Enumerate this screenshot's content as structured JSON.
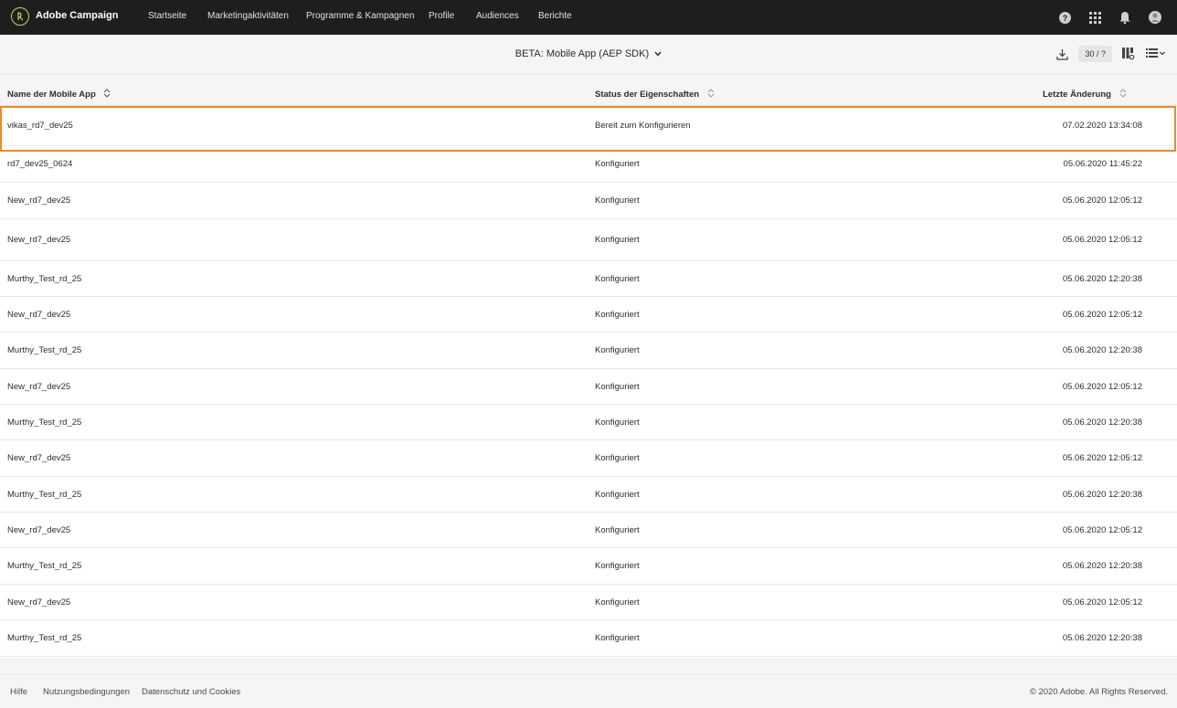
{
  "app": {
    "brand": "Adobe Campaign",
    "accent_color": "#c9d35a"
  },
  "nav": {
    "items": [
      "Startseite",
      "Marketingaktivitäten",
      "Programme & Kampagnen",
      "Profile",
      "Audiences",
      "Berichte"
    ],
    "icons": [
      "help-icon",
      "apps-grid-icon",
      "bell-icon",
      "user-avatar-icon"
    ]
  },
  "toolbar": {
    "view_title": "BETA: Mobile App (AEP SDK)",
    "counter": "30 / ?",
    "icons": [
      "download-icon",
      "column-config-icon",
      "list-view-icon"
    ]
  },
  "table": {
    "headers": {
      "name": "Name der Mobile App",
      "status": "Status der Eigenschaften",
      "modified": "Letzte Änderung"
    },
    "selected_row": 0,
    "highlight_color": "#e88b2e",
    "rows": [
      {
        "name": "vikas_rd7_dev25",
        "status": "Bereit zum Konfigurieren",
        "modified": "07.02.2020 13:34:08"
      },
      {
        "name": "rd7_dev25_0624",
        "status": "Konfiguriert",
        "modified": "05.06.2020 11:45:22"
      },
      {
        "name": "New_rd7_dev25",
        "status": "Konfiguriert",
        "modified": "05.06.2020 12:05:12"
      },
      {
        "name": "New_rd7_dev25",
        "status": "Konfiguriert",
        "modified": "05.06.2020 12:05:12"
      },
      {
        "name": "Murthy_Test_rd_25",
        "status": "Konfiguriert",
        "modified": "05.06.2020 12:20:38"
      },
      {
        "name": "New_rd7_dev25",
        "status": "Konfiguriert",
        "modified": "05.06.2020 12:05:12"
      },
      {
        "name": "Murthy_Test_rd_25",
        "status": "Konfiguriert",
        "modified": "05.06.2020 12:20:38"
      },
      {
        "name": "New_rd7_dev25",
        "status": "Konfiguriert",
        "modified": "05.06.2020 12:05:12"
      },
      {
        "name": "Murthy_Test_rd_25",
        "status": "Konfiguriert",
        "modified": "05.06.2020 12:20:38"
      },
      {
        "name": "New_rd7_dev25",
        "status": "Konfiguriert",
        "modified": "05.06.2020 12:05:12"
      },
      {
        "name": "Murthy_Test_rd_25",
        "status": "Konfiguriert",
        "modified": "05.06.2020 12:20:38"
      },
      {
        "name": "New_rd7_dev25",
        "status": "Konfiguriert",
        "modified": "05.06.2020 12:05:12"
      },
      {
        "name": "Murthy_Test_rd_25",
        "status": "Konfiguriert",
        "modified": "05.06.2020 12:20:38"
      },
      {
        "name": "New_rd7_dev25",
        "status": "Konfiguriert",
        "modified": "05.06.2020 12:05:12"
      },
      {
        "name": "Murthy_Test_rd_25",
        "status": "Konfiguriert",
        "modified": "05.06.2020 12:20:38"
      }
    ]
  },
  "footer": {
    "links": [
      "Hilfe",
      "Nutzungsbedingungen",
      "Datenschutz und Cookies"
    ],
    "copyright": "© 2020 Adobe. All Rights Reserved."
  }
}
